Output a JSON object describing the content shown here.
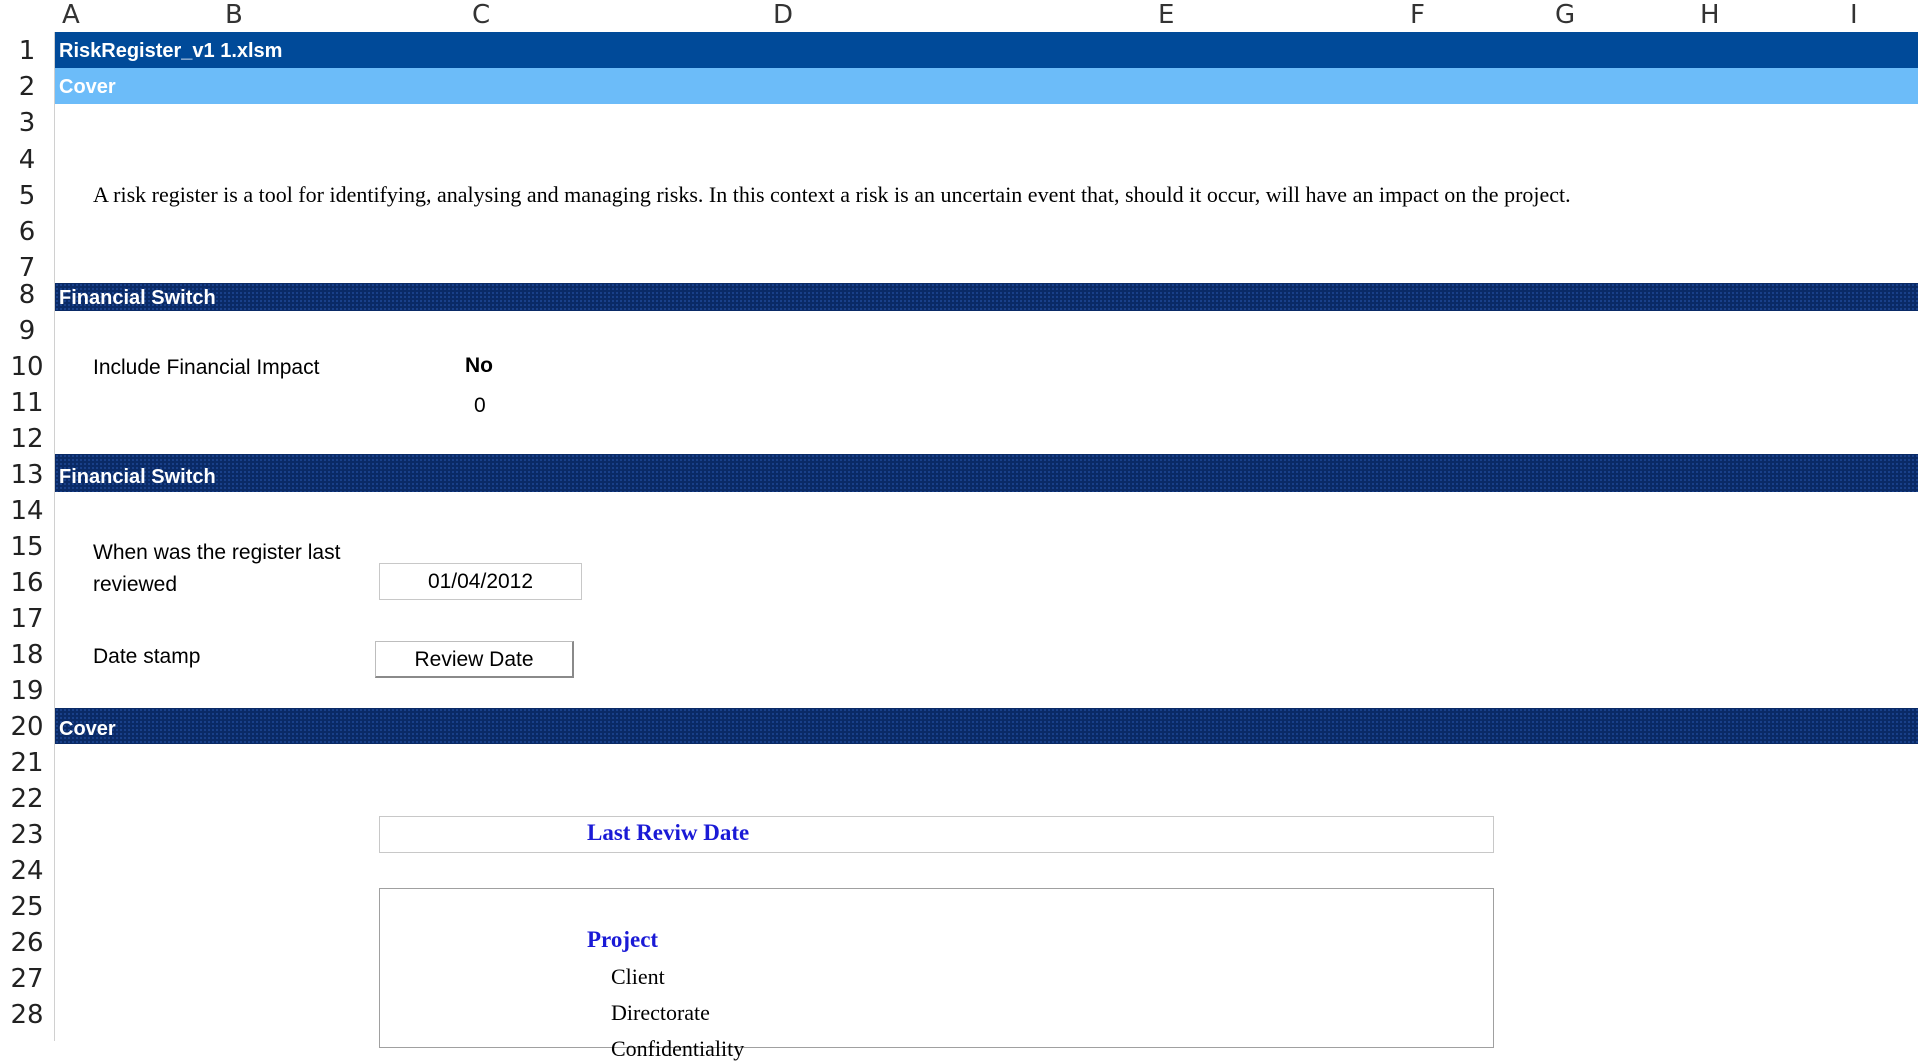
{
  "columns": [
    "A",
    "B",
    "C",
    "D",
    "E",
    "F",
    "G",
    "H",
    "I"
  ],
  "rows": [
    "1",
    "2",
    "3",
    "4",
    "5",
    "6",
    "7",
    "8",
    "9",
    "10",
    "11",
    "12",
    "13",
    "14",
    "15",
    "16",
    "17",
    "18",
    "19",
    "20",
    "21",
    "22",
    "23",
    "24",
    "25",
    "26",
    "27",
    "28"
  ],
  "title_band": "RiskRegister_v1 1.xlsm",
  "cover_band": "Cover",
  "intro_text": "A risk register is a tool for identifying, analysing and managing risks.  In this context a risk is an uncertain event that, should it occur, will have an impact on the project.",
  "section1": {
    "band": "Financial Switch",
    "label": "Include Financial Impact",
    "value": "No",
    "flag": "0"
  },
  "section2": {
    "band": "Financial Switch",
    "review_label_line1": "When was the register last",
    "review_label_line2": "reviewed",
    "review_date": "01/04/2012",
    "date_stamp_label": "Date stamp",
    "review_button": "Review Date"
  },
  "section3": {
    "band": "Cover",
    "last_review_heading": "Last Reviw Date",
    "project_heading": "Project",
    "items": [
      "Client",
      "Directorate",
      "Confidentiality"
    ]
  },
  "colors": {
    "title_band": "#004a99",
    "cover_band": "#6cbcf9",
    "dark_band": "#0a2a66",
    "accent_text": "#1a1ad6"
  }
}
